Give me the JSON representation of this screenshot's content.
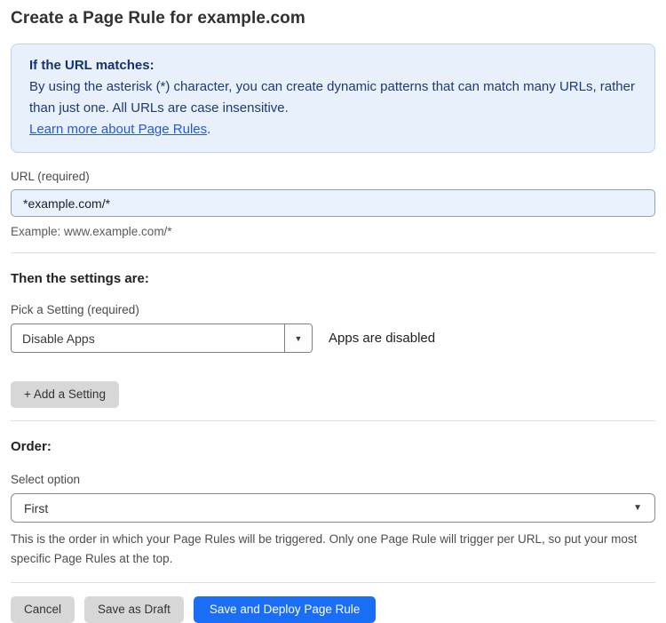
{
  "page": {
    "title": "Create a Page Rule for example.com"
  },
  "info_box": {
    "heading": "If the URL matches:",
    "body": "By using the asterisk (*) character, you can create dynamic patterns that can match many URLs, rather than just one. All URLs are case insensitive.",
    "link_label": "Learn more about Page Rules",
    "link_suffix": "."
  },
  "url_field": {
    "label": "URL (required)",
    "value": "*example.com/*",
    "example": "Example: www.example.com/*"
  },
  "settings_section": {
    "heading": "Then the settings are:",
    "picker_label": "Pick a Setting (required)",
    "picker_value": "Disable Apps",
    "status_text": "Apps are disabled",
    "add_setting_label": "+ Add a Setting"
  },
  "order_section": {
    "heading": "Order:",
    "select_label": "Select option",
    "select_value": "First",
    "help_text": "This is the order in which your Page Rules will be triggered. Only one Page Rule will trigger per URL, so put your most specific Page Rules at the top."
  },
  "actions": {
    "cancel_label": "Cancel",
    "save_draft_label": "Save as Draft",
    "save_deploy_label": "Save and Deploy Page Rule"
  },
  "icons": {
    "dropdown_arrow_glyph": "▼"
  },
  "colors": {
    "accent_blue": "#1a6ef5",
    "info_box_bg": "#e8f1fb",
    "info_box_border": "#b9d4f0",
    "info_text": "#1d3a73",
    "link_blue": "#2458d8",
    "url_input_bg": "#e9f1fc",
    "gray_button_bg": "#d7d7d7"
  }
}
